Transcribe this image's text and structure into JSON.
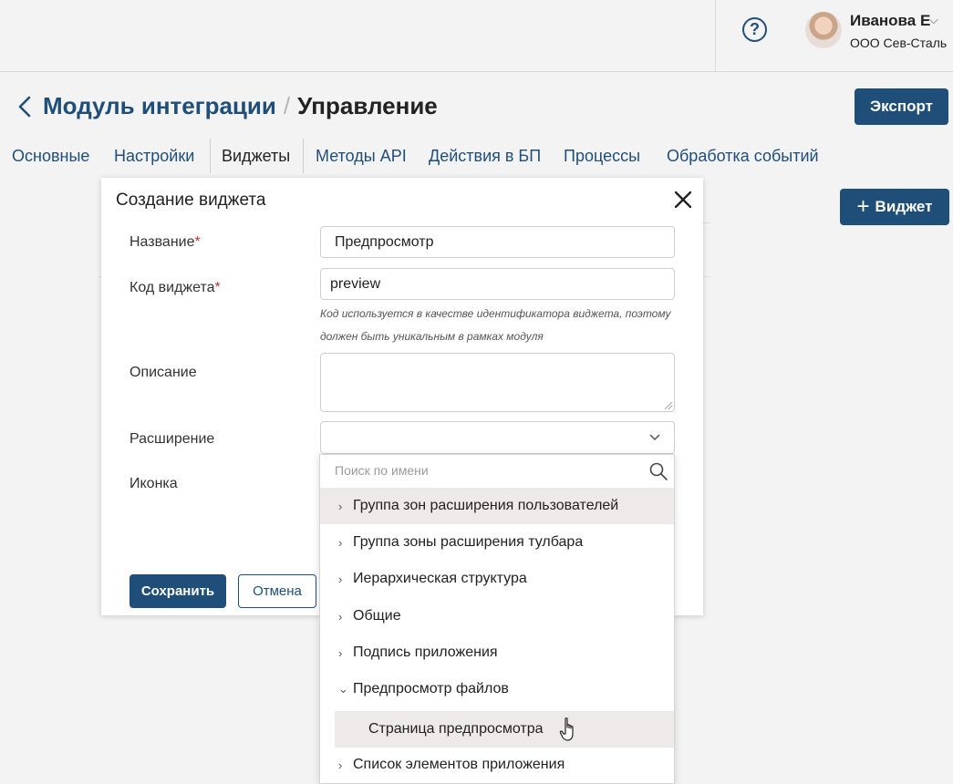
{
  "header": {
    "help_symbol": "?",
    "user": {
      "name": "Иванова Е",
      "caret": "⌵",
      "org": "ООО Сев-Сталь"
    }
  },
  "page": {
    "module": "Модуль интеграции",
    "separator": "/",
    "section": "Управление",
    "export_label": "Экспорт"
  },
  "tabs": [
    {
      "label": "Основные"
    },
    {
      "label": "Настройки"
    },
    {
      "label": "Виджеты",
      "active": true
    },
    {
      "label": "Методы API"
    },
    {
      "label": "Действия в БП"
    },
    {
      "label": "Процессы"
    },
    {
      "label": "Обработка событий"
    }
  ],
  "add_widget_label": "Виджет",
  "modal": {
    "title": "Создание виджета",
    "fields": {
      "name_label": "Название",
      "name_value": "Предпросмотр",
      "code_label": "Код виджета",
      "code_value": "preview",
      "code_hint_1": "Код используется в качестве идентификатора виджета, поэтому",
      "code_hint_2": "должен быть уникальным в рамках модуля",
      "description_label": "Описание",
      "extension_label": "Расширение",
      "icon_label": "Иконка",
      "required_mark": "*"
    },
    "save_label": "Сохранить",
    "cancel_label": "Отмена"
  },
  "dropdown": {
    "search_placeholder": "Поиск по имени",
    "items": [
      {
        "label": "Группа зон расширения пользователей",
        "arrow": "›",
        "highlighted": true
      },
      {
        "label": "Группа зоны расширения тулбара",
        "arrow": "›"
      },
      {
        "label": "Иерархическая структура",
        "arrow": "›"
      },
      {
        "label": "Общие",
        "arrow": "›"
      },
      {
        "label": "Подпись приложения",
        "arrow": "›"
      },
      {
        "label": "Предпросмотр файлов",
        "arrow": "⌄",
        "expanded": true
      },
      {
        "label": "Список элементов приложения",
        "arrow": "›"
      }
    ],
    "sub_item": "Страница предпросмотра"
  },
  "colors": {
    "accent": "#1f4e79",
    "required": "#c0392b",
    "hover": "#eeeaea"
  }
}
